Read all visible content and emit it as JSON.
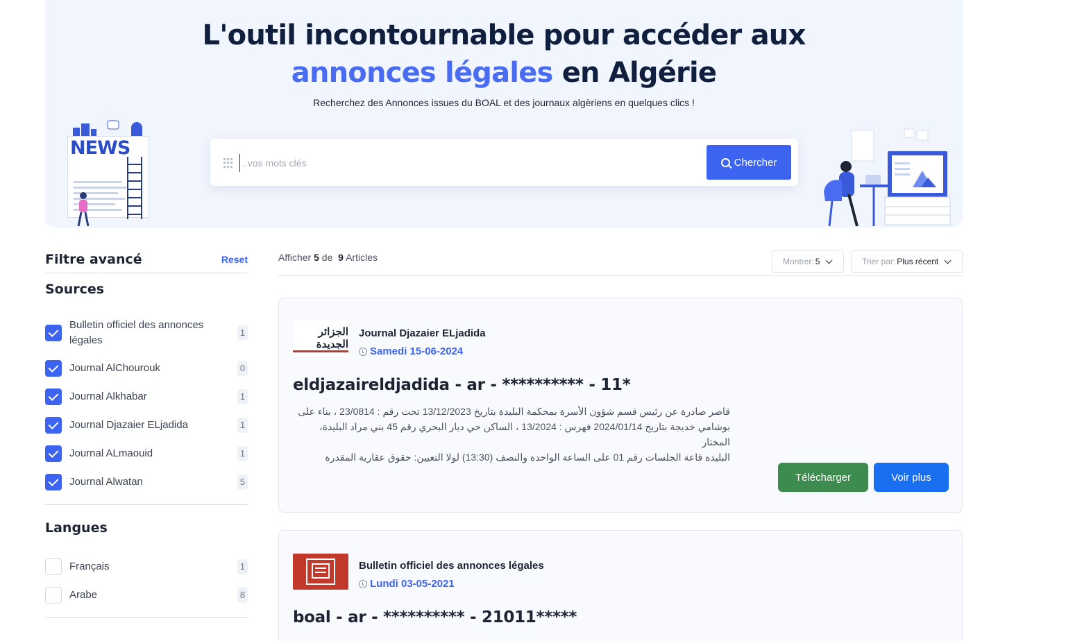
{
  "hero": {
    "title_line1": "L'outil incontournable pour accéder aux",
    "title_accent": "annonces légales",
    "title_line2_rest": " en Algérie",
    "subtitle": "Recherchez des Annonces issues du BOAL et des journaux algèriens en quelques clics !",
    "search_placeholder": "..vos mots clés",
    "search_button": "Chercher",
    "news_illustration_text": "NEWS"
  },
  "sidebar": {
    "title": "Filtre avancé",
    "reset": "Reset",
    "sources_title": "Sources",
    "sources": [
      {
        "label": "Bulletin officiel des annonces légales",
        "count": "1",
        "checked": true
      },
      {
        "label": "Journal AlChourouk",
        "count": "0",
        "checked": true
      },
      {
        "label": "Journal Alkhabar",
        "count": "1",
        "checked": true
      },
      {
        "label": "Journal Djazaier ELjadida",
        "count": "1",
        "checked": true
      },
      {
        "label": "Journal ALmaouid",
        "count": "1",
        "checked": true
      },
      {
        "label": "Journal Alwatan",
        "count": "5",
        "checked": true
      }
    ],
    "langues_title": "Langues",
    "langues": [
      {
        "label": "Français",
        "count": "1",
        "checked": false
      },
      {
        "label": "Arabe",
        "count": "8",
        "checked": false
      }
    ]
  },
  "results": {
    "prefix": "Afficher",
    "shown": "5",
    "middle": "de",
    "total": "9",
    "suffix": "Articles",
    "show_label": "Montrer:",
    "show_value": "5",
    "sort_label": "Trier par:",
    "sort_value": "Plus récent"
  },
  "articles": [
    {
      "source": "Journal Djazaier ELjadida",
      "date": "Samedi 15-06-2024",
      "logo_text": "الجزائر الجديدة",
      "title": "eldjazaireldjadida - ar - ********** - 11*",
      "excerpt_lines": [
        "قاصر صادرة عن رئيس قسم شؤون الأسرة بمحكمة البليدة بتاريخ 13/12/2023 تحت رقم : 23/0814 ، بناء على",
        "بوشامي خديجة بتاريخ 2024/01/14 فهرس : 13/2024 ، الساكن حي ديار البحري رقم 45 بني مراد البليدة، المختار",
        "البليدة قاعة الجلسات رقم 01 على الساعة الواحدة والنصف (13:30) لولا التعيين: حقوق عقارية المقدرة"
      ],
      "download": "Télécharger",
      "more": "Voir plus"
    },
    {
      "source": "Bulletin officiel des annonces légales",
      "date": "Lundi 03-05-2021",
      "title": "boal - ar - ********** - 21011*****"
    }
  ],
  "colors": {
    "accent": "#3d64f0",
    "download": "#3d8b4f",
    "more": "#1a6ef0",
    "hero_bg": "#f1f5fd"
  }
}
